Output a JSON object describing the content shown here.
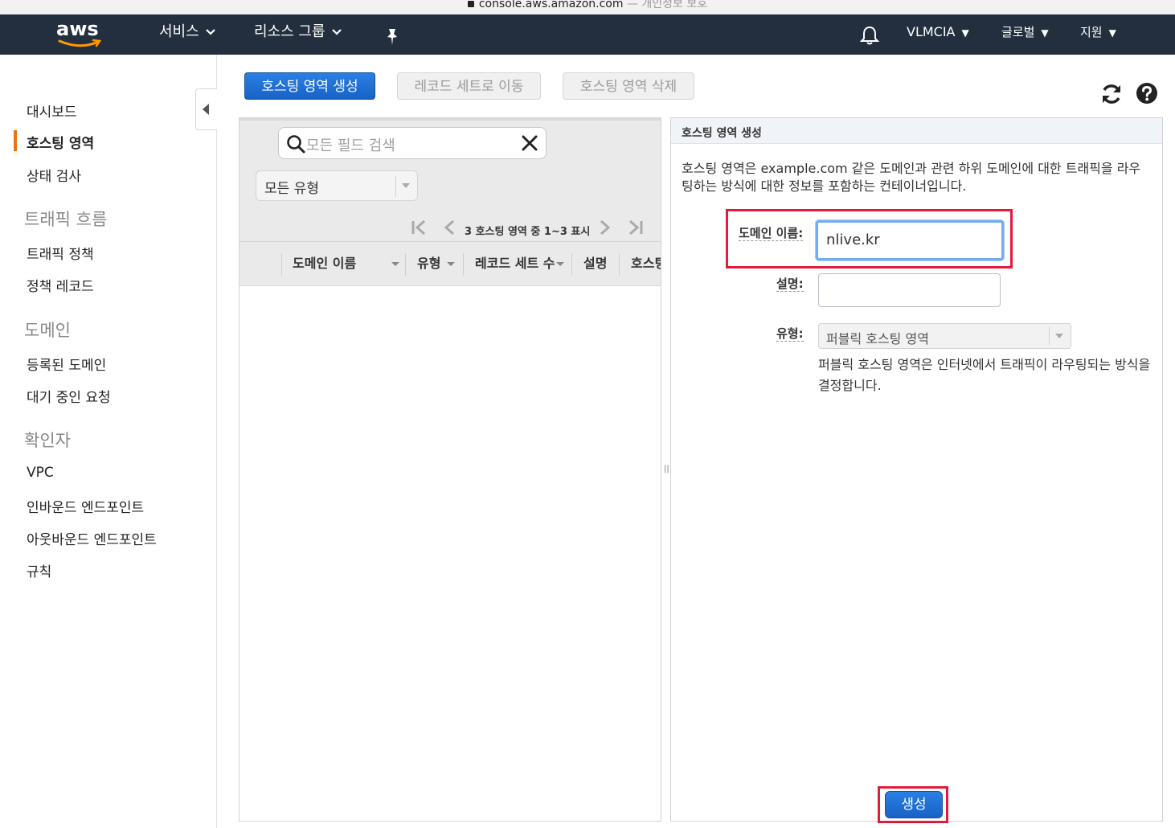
{
  "browser": {
    "url": "console.aws.amazon.com",
    "suffix": "— 개인정보 보호"
  },
  "topnav": {
    "logo": "aws",
    "services": "서비스",
    "resource_groups": "리소스 그룹",
    "pin_icon": "pin-icon",
    "bell_icon": "bell-icon",
    "account": "VLMCIA",
    "region": "글로벌",
    "support": "지원"
  },
  "sidebar": {
    "items": [
      {
        "label": "대시보드"
      },
      {
        "label": "호스팅 영역",
        "active": true
      },
      {
        "label": "상태 검사"
      }
    ],
    "sections": [
      {
        "title": "트래픽 흐름",
        "items": [
          "트래픽 정책",
          "정책 레코드"
        ]
      },
      {
        "title": "도메인",
        "items": [
          "등록된 도메인",
          "대기 중인 요청"
        ]
      },
      {
        "title": "확인자",
        "items": [
          "VPC",
          "인바운드 엔드포인트",
          "아웃바운드 엔드포인트",
          "규칙"
        ]
      }
    ]
  },
  "toolbar": {
    "create_zone": "호스팅 영역 생성",
    "goto_records": "레코드 세트로 이동",
    "delete_zone": "호스팅 영역 삭제"
  },
  "list": {
    "search_placeholder": "모든 필드 검색",
    "type_filter": "모든 유형",
    "pager_text": "3 호스팅 영역 중 1~3 표시",
    "columns": [
      "도메인 이름",
      "유형",
      "레코드 세트 수",
      "설명",
      "호스팅"
    ]
  },
  "form": {
    "header": "호스팅 영역 생성",
    "description": "호스팅 영역은 example.com 같은 도메인과 관련 하위 도메인에 대한 트래픽을 라우팅하는 방식에 대한 정보를 포함하는 컨테이너입니다.",
    "domain_label": "도메인 이름:",
    "domain_value": "nlive.kr",
    "comment_label": "설명:",
    "comment_value": "",
    "type_label": "유형:",
    "type_value": "퍼블릭 호스팅 영역",
    "type_help": "퍼블릭 호스팅 영역은 인터넷에서 트래픽이 라우팅되는 방식을 결정합니다.",
    "submit": "생성"
  },
  "colors": {
    "nav_bg": "#232f3e",
    "primary": "#1f6fd0",
    "active_marker": "#ec7211",
    "highlight": "#e31b3a"
  }
}
